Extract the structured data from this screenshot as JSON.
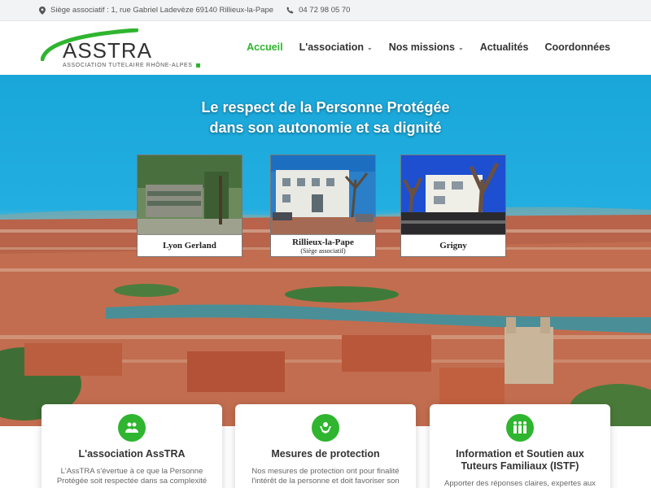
{
  "topbar": {
    "address": "Siège associatif : 1, rue Gabriel Ladevèze 69140 Rillieux-la-Pape",
    "phone": "04 72 98 05 70"
  },
  "logo": {
    "name": "ASSTRA",
    "tagline": "ASSOCIATION TUTELAIRE RHÔNE-ALPES"
  },
  "nav": {
    "items": [
      {
        "label": "Accueil",
        "active": true
      },
      {
        "label": "L'association",
        "dropdown": true
      },
      {
        "label": "Nos missions",
        "dropdown": true
      },
      {
        "label": "Actualités"
      },
      {
        "label": "Coordonnées"
      }
    ]
  },
  "hero": {
    "title_line1": "Le respect de la Personne Protégée",
    "title_line2": "dans son autonomie et sa dignité"
  },
  "sites": [
    {
      "name": "Lyon Gerland",
      "sub": ""
    },
    {
      "name": "Rillieux-la-Pape",
      "sub": "(Siège associatif)"
    },
    {
      "name": "Grigny",
      "sub": ""
    }
  ],
  "features": [
    {
      "title": "L'association AssTRA",
      "text": "L'AssTRA s'évertue à ce que la Personne Protégée soit respectée dans sa complexité et sa",
      "icon": "group-icon"
    },
    {
      "title": "Mesures de protection",
      "text": "Nos mesures de protection ont pour finalité l'intérêt de la personne et doit favoriser son",
      "icon": "hands-protect-icon"
    },
    {
      "title": "Information et Soutien aux Tuteurs Familiaux (ISTF)",
      "text": "Apporter des réponses claires, expertes aux",
      "icon": "family-icon"
    }
  ],
  "colors": {
    "accent": "#2fb52f",
    "sky": "#1ea9dc",
    "topbar_bg": "#f2f3f4"
  }
}
